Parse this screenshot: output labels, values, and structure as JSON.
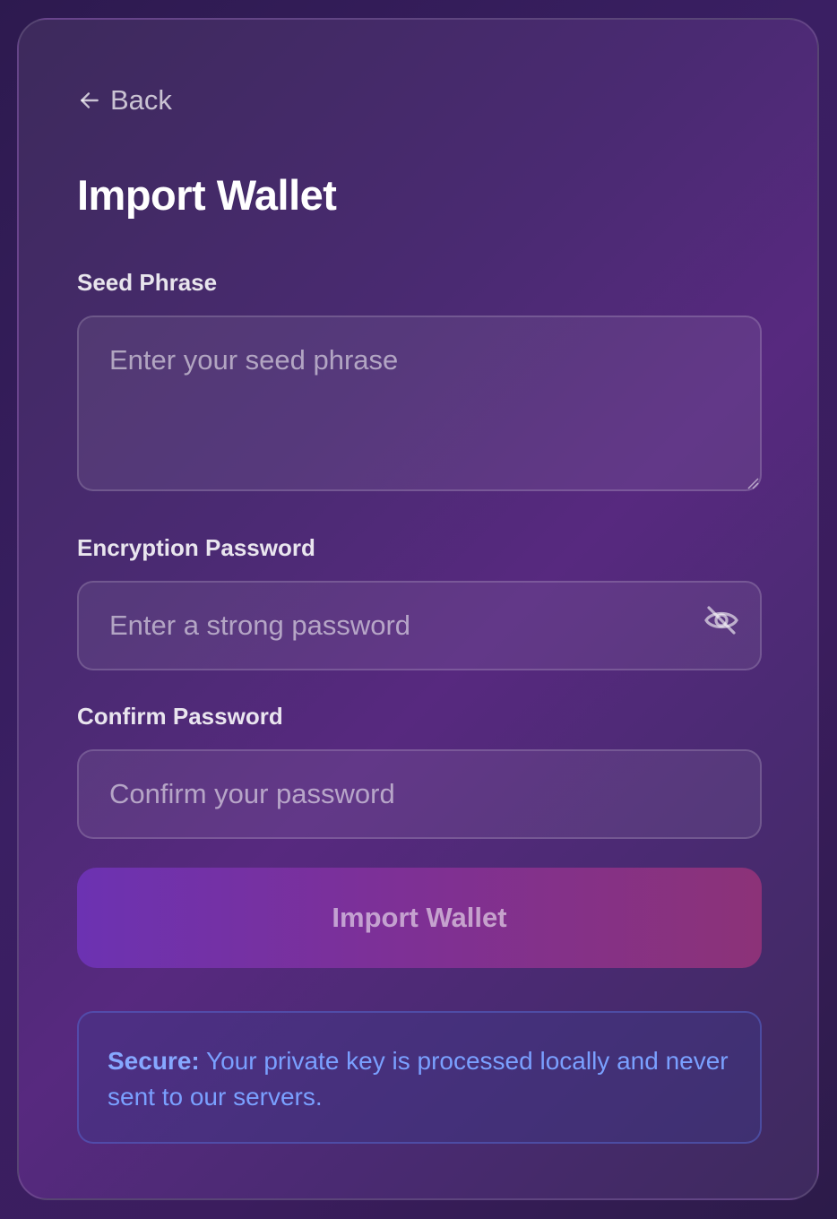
{
  "back": {
    "label": "Back"
  },
  "page": {
    "title": "Import Wallet"
  },
  "seed_phrase": {
    "label": "Seed Phrase",
    "placeholder": "Enter your seed phrase",
    "value": ""
  },
  "encryption_password": {
    "label": "Encryption Password",
    "placeholder": "Enter a strong password",
    "value": "",
    "visibility_icon": "eye-slash-icon"
  },
  "confirm_password": {
    "label": "Confirm Password",
    "placeholder": "Confirm your password",
    "value": ""
  },
  "submit": {
    "label": "Import Wallet"
  },
  "notice": {
    "emphasis": "Secure:",
    "text": " Your private key is processed locally and never sent to our servers."
  },
  "colors": {
    "accent_start": "#6c32b2",
    "accent_end": "#8c3278",
    "notice_text": "#7aa0ff"
  }
}
